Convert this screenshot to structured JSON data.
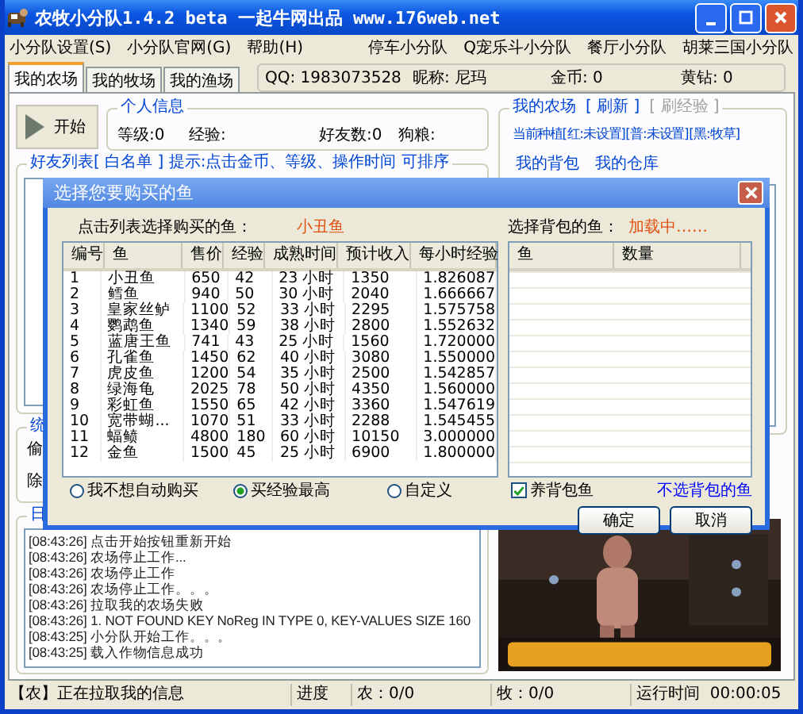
{
  "window": {
    "title": "农牧小分队1.4.2 beta 一起牛网出品 www.176web.net"
  },
  "menu": {
    "left": [
      "小分队设置(S)",
      "小分队官网(G)",
      "帮助(H)"
    ],
    "right": [
      "停车小分队",
      "Q宠乐斗小分队",
      "餐厅小分队",
      "胡莱三国小分队"
    ]
  },
  "tabs": [
    {
      "label": "我的农场",
      "selected": true
    },
    {
      "label": "我的牧场",
      "selected": false
    },
    {
      "label": "我的渔场",
      "selected": false
    }
  ],
  "account": [
    {
      "label": "QQ:",
      "value": "1983073528"
    },
    {
      "label": "昵称:",
      "value": "尼玛"
    },
    {
      "label": "金币:",
      "value": "0"
    },
    {
      "label": "黄钻:",
      "value": "0"
    }
  ],
  "start_button": "开始",
  "personal_info": {
    "title": "个人信息",
    "fields": [
      {
        "label": "等级:",
        "value": "0"
      },
      {
        "label": "经验:"
      },
      {
        "label": "好友数:",
        "value": "0"
      },
      {
        "label": "狗粮:"
      }
    ]
  },
  "friend_list": {
    "title": "好友列表[ 白名单 ]  提示:点击金币、等级、操作时间 可排序"
  },
  "stats_fragments": {
    "title": "统",
    "lines": [
      "偷",
      "除"
    ]
  },
  "log": {
    "title": "日",
    "lines": [
      "[08:43:26] 点击开始按钮重新开始",
      "[08:43:26] 农场停止工作...",
      "[08:43:26] 农场停止工作",
      "[08:43:26] 农场停止工作。。。",
      "[08:43:26] 拉取我的农场失败",
      "[08:43:26] 1. NOT FOUND KEY NoReg IN TYPE 0, KEY-VALUES SIZE 160",
      "[08:43:25] 小分队开始工作。。。",
      "[08:43:25] 载入作物信息成功"
    ]
  },
  "my_farm": {
    "title": "我的农场",
    "links": [
      {
        "label": "[ 刷新 ]",
        "disabled": false
      },
      {
        "label": "[ 刷经验 ]",
        "disabled": true
      }
    ],
    "planting": "当前种植[红:未设置][普:未设置][黑:牧草]",
    "actions": [
      "我的背包",
      "我的仓库"
    ]
  },
  "dialog": {
    "title": "选择您要购买的鱼",
    "pick_label": "点击列表选择购买的鱼：",
    "picked": "小丑鱼",
    "bag_label": "选择背包的鱼：",
    "bag_status": "加载中……",
    "fish_table": {
      "columns": [
        "编号",
        "鱼",
        "售价",
        "经验",
        "成熟时间",
        "预计收入",
        "每小时经验"
      ],
      "rows": [
        [
          "1",
          "小丑鱼",
          "650",
          "42",
          "23 小时",
          "1350",
          "1.826087"
        ],
        [
          "2",
          "鳕鱼",
          "940",
          "50",
          "30 小时",
          "2040",
          "1.666667"
        ],
        [
          "3",
          "皇家丝鲈",
          "1100",
          "52",
          "33 小时",
          "2295",
          "1.575758"
        ],
        [
          "4",
          "鹦鹉鱼",
          "1340",
          "59",
          "38 小时",
          "2800",
          "1.552632"
        ],
        [
          "5",
          "蓝唐王鱼",
          "741",
          "43",
          "25 小时",
          "1560",
          "1.720000"
        ],
        [
          "6",
          "孔雀鱼",
          "1450",
          "62",
          "40 小时",
          "3080",
          "1.550000"
        ],
        [
          "7",
          "虎皮鱼",
          "1200",
          "54",
          "35 小时",
          "2500",
          "1.542857"
        ],
        [
          "8",
          "绿海龟",
          "2025",
          "78",
          "50 小时",
          "4350",
          "1.560000"
        ],
        [
          "9",
          "彩虹鱼",
          "1550",
          "65",
          "42 小时",
          "3360",
          "1.547619"
        ],
        [
          "10",
          "宽带蝴...",
          "1070",
          "51",
          "33 小时",
          "2288",
          "1.545455"
        ],
        [
          "11",
          "蝠鲼",
          "4800",
          "180",
          "60 小时",
          "10150",
          "3.000000"
        ],
        [
          "12",
          "金鱼",
          "1500",
          "45",
          "25 小时",
          "6900",
          "1.800000"
        ]
      ]
    },
    "bag_table": {
      "columns": [
        "鱼",
        "数量"
      ]
    },
    "buy_modes": [
      {
        "label": "我不想自动购买",
        "selected": false
      },
      {
        "label": "买经验最高",
        "selected": true
      },
      {
        "label": "自定义",
        "selected": false
      }
    ],
    "raise_bag_fish": {
      "label": "养背包鱼",
      "checked": true
    },
    "deselect_link": "不选背包的鱼",
    "buttons": [
      "确定",
      "取消"
    ]
  },
  "status_bar": {
    "message": "【农】正在拉取我的信息",
    "progress_label": "进度",
    "farm": "农：0/0",
    "ranch": "牧：0/0",
    "runtime_label": "运行时间",
    "runtime": "00:00:05"
  }
}
